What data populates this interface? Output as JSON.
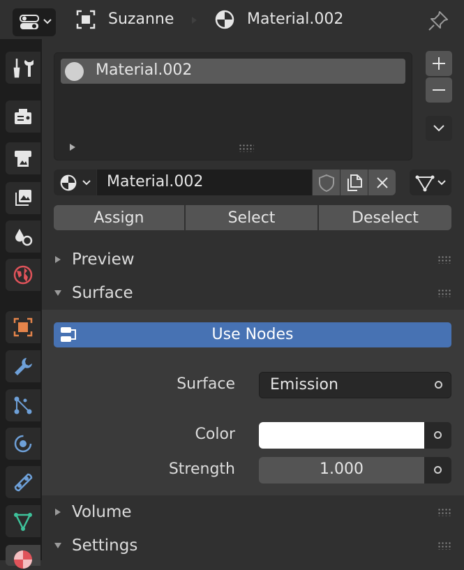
{
  "header": {
    "object_name": "Suzanne",
    "material_name": "Material.002"
  },
  "sidebar": {
    "tabs": [
      {
        "icon": "tool-icon"
      },
      {
        "icon": "render-icon"
      },
      {
        "icon": "output-icon"
      },
      {
        "icon": "view-layer-icon"
      },
      {
        "icon": "scene-icon"
      },
      {
        "icon": "world-icon"
      },
      {
        "icon": "object-icon"
      },
      {
        "icon": "modifier-wrench-icon"
      },
      {
        "icon": "particles-icon"
      },
      {
        "icon": "physics-icon"
      },
      {
        "icon": "constraints-icon"
      },
      {
        "icon": "object-data-icon"
      },
      {
        "icon": "material-icon",
        "active": true
      }
    ]
  },
  "material_slots": {
    "items": [
      "Material.002"
    ]
  },
  "datablock": {
    "name": "Material.002"
  },
  "actions": {
    "assign": "Assign",
    "select": "Select",
    "deselect": "Deselect"
  },
  "panels": {
    "preview": "Preview",
    "surface": "Surface",
    "volume": "Volume",
    "settings": "Settings"
  },
  "surface": {
    "use_nodes": "Use Nodes",
    "surface_label": "Surface",
    "surface_value": "Emission",
    "color_label": "Color",
    "color_value": "#ffffff",
    "strength_label": "Strength",
    "strength_value": "1.000"
  },
  "colors": {
    "accent_blue": "#4772b3",
    "background": "#303030",
    "sidebar": "#1d1d1d"
  }
}
